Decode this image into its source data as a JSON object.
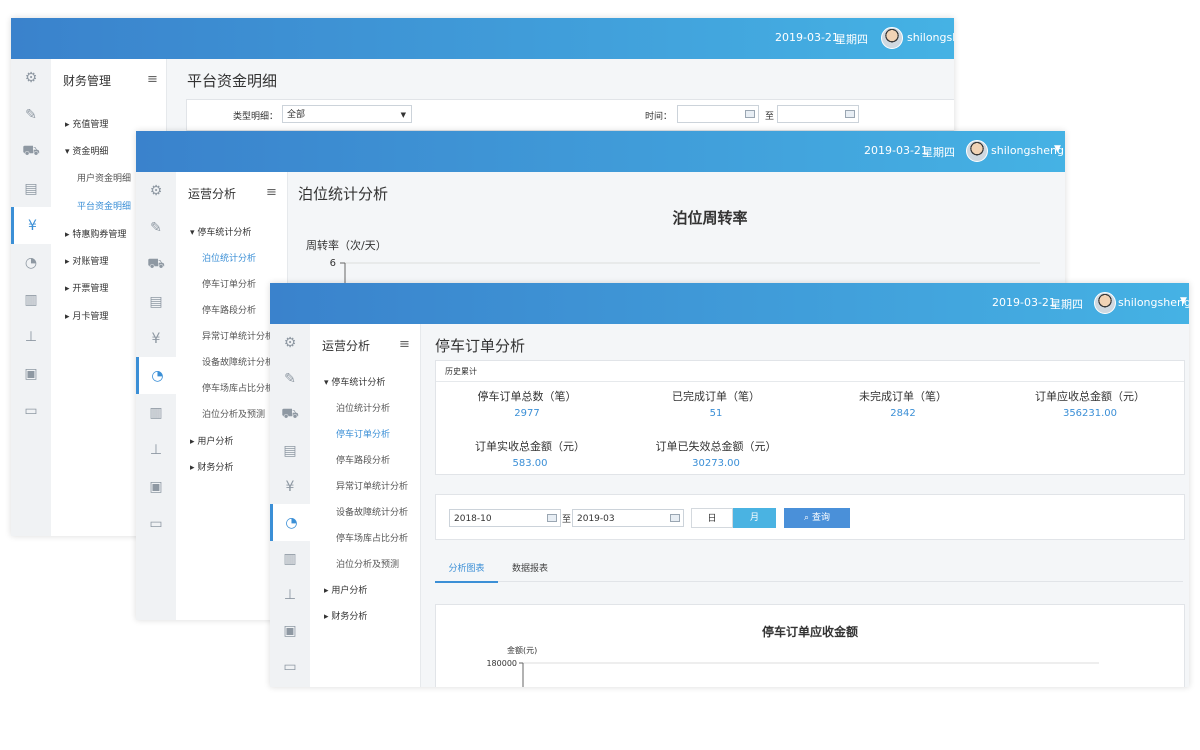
{
  "windows": {
    "finance": {
      "date": "2019-03-21",
      "weekday": "星期四",
      "username": "shilongsheng",
      "sidebar_title": "财务管理",
      "groups": [
        {
          "label": "充值管理"
        },
        {
          "label": "资金明细",
          "items": [
            "用户资金明细",
            "平台资金明细"
          ]
        },
        {
          "label": "特惠购券管理"
        },
        {
          "label": "对账管理"
        },
        {
          "label": "开票管理"
        },
        {
          "label": "月卡管理"
        }
      ],
      "active_item": "平台资金明细",
      "page_title": "平台资金明细",
      "filter": {
        "type_label": "类型明细：",
        "type_value": "全部",
        "time_label": "时间：",
        "to": "至"
      }
    },
    "berth": {
      "date": "2019-03-21",
      "weekday": "星期四",
      "username": "shilongsheng",
      "sidebar_title": "运营分析",
      "group_label": "停车统计分析",
      "items": [
        "泊位统计分析",
        "停车订单分析",
        "停车路段分析",
        "异常订单统计分析",
        "设备故障统计分析",
        "停车场库占比分析",
        "泊位分析及预测"
      ],
      "active_item": "泊位统计分析",
      "other_groups": [
        "用户分析",
        "财务分析"
      ],
      "page_title": "泊位统计分析",
      "chart_data": {
        "type": "line",
        "title": "泊位周转率",
        "ylabel": "周转率（次/天）",
        "yticks": [
          6
        ]
      }
    },
    "orders": {
      "date": "2019-03-21",
      "weekday": "星期四",
      "username": "shilongsheng",
      "sidebar_title": "运营分析",
      "group_label": "停车统计分析",
      "items": [
        "泊位统计分析",
        "停车订单分析",
        "停车路段分析",
        "异常订单统计分析",
        "设备故障统计分析",
        "停车场库占比分析",
        "泊位分析及预测"
      ],
      "active_item": "停车订单分析",
      "other_groups": [
        "用户分析",
        "财务分析"
      ],
      "page_title": "停车订单分析",
      "history_label": "历史累计",
      "stats": [
        {
          "label": "停车订单总数（笔）",
          "value": "2977"
        },
        {
          "label": "已完成订单（笔）",
          "value": "51"
        },
        {
          "label": "未完成订单（笔）",
          "value": "2842"
        },
        {
          "label": "订单应收总金额（元）",
          "value": "356231.00"
        },
        {
          "label": "订单实收总金额（元）",
          "value": "583.00"
        },
        {
          "label": "订单已失效总金额（元）",
          "value": "30273.00"
        }
      ],
      "filter": {
        "start": "2018-10",
        "to": "至",
        "end": "2019-03",
        "day": "日",
        "month": "月",
        "query": "查询"
      },
      "tabs": [
        "分析图表",
        "数据报表"
      ],
      "active_tab": "分析图表",
      "chart_data": {
        "type": "bar",
        "title": "停车订单应收金额",
        "ylabel": "金额(元)",
        "yticks": [
          180000
        ]
      }
    }
  },
  "icons": [
    "user-settings-icon",
    "user-edit-icon",
    "car-icon",
    "parking-lot-icon",
    "money-bag-icon",
    "pie-chart-icon",
    "presentation-icon",
    "org-chart-icon",
    "briefcase-icon",
    "monitor-icon"
  ],
  "colors": {
    "header_start": "#3a82cc",
    "header_end": "#45b2e4",
    "accent": "#3b8fd6",
    "month_button": "#4ab3e2",
    "query_button": "#4a90d9"
  }
}
